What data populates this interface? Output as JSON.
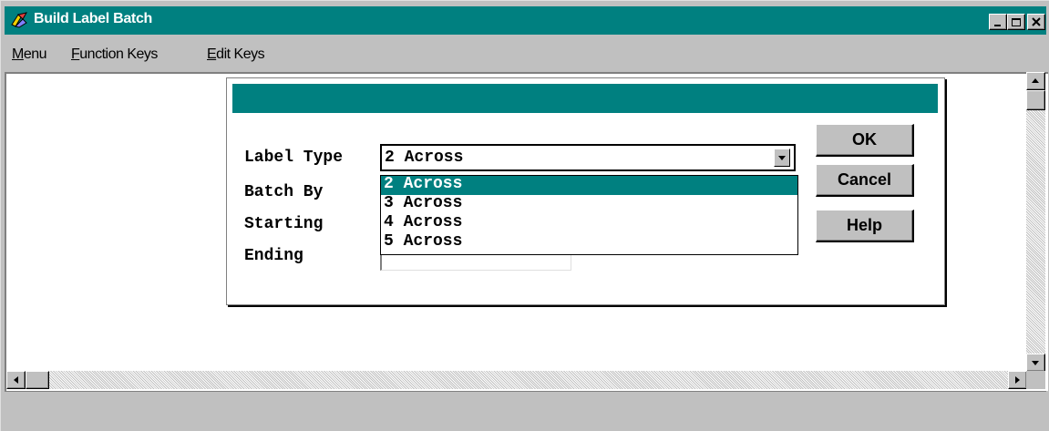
{
  "window": {
    "title": "Build Label Batch",
    "icon": "app-icon",
    "controls": {
      "minimize": "minimize-icon",
      "maximize": "maximize-icon",
      "close": "close-icon"
    }
  },
  "menu": {
    "items": [
      {
        "label": "Menu"
      },
      {
        "label": "Function Keys"
      },
      {
        "label": "Edit Keys"
      }
    ]
  },
  "dialog": {
    "title": "",
    "fields": {
      "label_type": "Label Type",
      "batch_by": "Batch By",
      "starting": "Starting",
      "ending": "Ending"
    },
    "combo": {
      "value": "2 Across",
      "options": [
        "2 Across",
        "3 Across",
        "4 Across",
        "5 Across"
      ],
      "selected_index": 0
    },
    "buttons": {
      "ok": "OK",
      "cancel": "Cancel",
      "help": "Help"
    }
  },
  "colors": {
    "titlebar": "#008080",
    "selection": "#008080",
    "face": "#c0c0c0"
  }
}
